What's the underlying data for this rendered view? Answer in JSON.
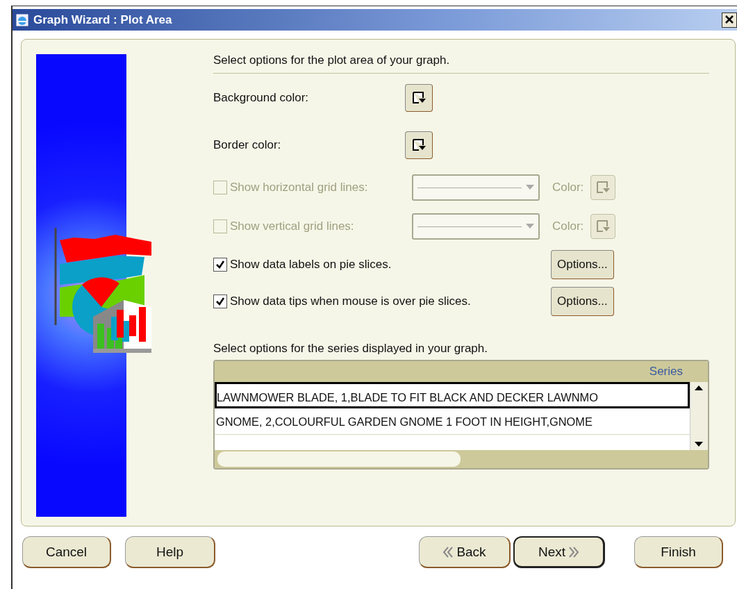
{
  "window": {
    "title": "Graph Wizard : Plot Area"
  },
  "intro": "Select options for the plot area of your graph.",
  "color_options": [
    {
      "label": "Background color:"
    },
    {
      "label": "Border color:"
    }
  ],
  "grid_options": [
    {
      "label": "Show horizontal grid lines:",
      "checked": false,
      "disabled": true,
      "color_label": "Color:"
    },
    {
      "label": "Show vertical grid lines:",
      "checked": false,
      "disabled": true,
      "color_label": "Color:"
    }
  ],
  "label_options": [
    {
      "label": "Show data labels on pie slices.",
      "checked": true,
      "button": "Options..."
    },
    {
      "label": "Show data tips when mouse is over pie slices.",
      "checked": true,
      "button": "Options..."
    }
  ],
  "series_intro": "Select options for the series displayed in your graph.",
  "series_table": {
    "columns": [
      "Series"
    ],
    "rows": [
      {
        "text": "LAWNMOWER BLADE, 1,BLADE TO FIT BLACK AND DECKER LAWNMO",
        "selected": true
      },
      {
        "text": "GNOME, 2,COLOURFUL GARDEN GNOME 1 FOOT IN HEIGHT,GNOME",
        "selected": false
      }
    ]
  },
  "buttons": [
    {
      "label": "Cancel",
      "kind": "plain",
      "default": false
    },
    {
      "label": "Help",
      "kind": "plain",
      "default": false
    },
    {
      "label": "Back",
      "kind": "back",
      "default": false
    },
    {
      "label": "Next",
      "kind": "next",
      "default": true
    },
    {
      "label": "Finish",
      "kind": "plain",
      "default": false
    }
  ]
}
